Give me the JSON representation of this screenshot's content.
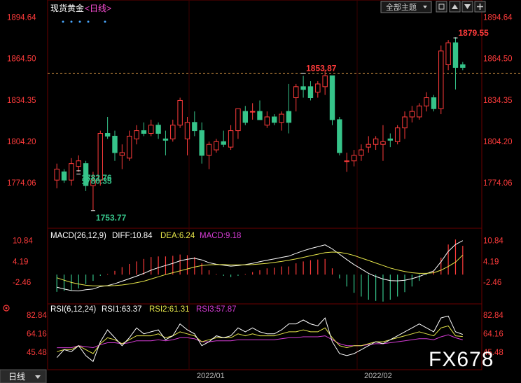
{
  "header": {
    "symbol": "现货黄金",
    "period_link": "<日线>",
    "theme_button": "全部主题",
    "window_controls": [
      "restore-icon",
      "up-icon",
      "down-icon",
      "plus-icon"
    ]
  },
  "price_axis": {
    "ticks": [
      "1894.64",
      "1864.50",
      "1834.35",
      "1804.20",
      "1774.06"
    ]
  },
  "macd_axis": {
    "ticks": [
      "10.84",
      "4.19",
      "-2.46"
    ]
  },
  "rsi_axis": {
    "ticks": [
      "82.84",
      "64.16",
      "45.48"
    ]
  },
  "time_axis": {
    "labels": [
      "2022/01",
      "2022/02"
    ]
  },
  "footer": {
    "period_tab": "日线",
    "watermark": "FX678"
  },
  "colors": {
    "up": "#ff3b3b",
    "down": "#36c48a",
    "dashed_level": "#e8a24a",
    "macd_diff": "#ffffff",
    "macd_dea": "#e6e64a",
    "rsi1": "#ffffff",
    "rsi2": "#e6e64a",
    "rsi3": "#d63cd6",
    "label_high": "#ff3b3b",
    "label_low": "#36c48a",
    "grid": "#6b0000"
  },
  "chart_data": [
    {
      "type": "candlestick",
      "title": "现货黄金",
      "ylim": [
        1745,
        1900
      ],
      "x_labels": [
        "2022/01",
        "2022/02"
      ],
      "reference_level": 1853.87,
      "annotations": [
        {
          "text": "1879.55",
          "value": 1879.55,
          "kind": "high"
        },
        {
          "text": "1853.87",
          "value": 1853.87,
          "kind": "high"
        },
        {
          "text": "1753.77",
          "value": 1753.77,
          "kind": "low"
        },
        {
          "text": "1782.76",
          "value": 1782.76,
          "kind": "low"
        },
        {
          "text": "1780.35",
          "value": 1780.35,
          "kind": "low"
        }
      ],
      "ohlc": [
        [
          1776,
          1788,
          1770,
          1784
        ],
        [
          1782,
          1784,
          1774,
          1776
        ],
        [
          1776,
          1792,
          1772,
          1788
        ],
        [
          1786,
          1794,
          1782,
          1790
        ],
        [
          1788,
          1790,
          1768,
          1772
        ],
        [
          1772,
          1782,
          1754,
          1776
        ],
        [
          1776,
          1812,
          1772,
          1810
        ],
        [
          1810,
          1822,
          1806,
          1808
        ],
        [
          1808,
          1812,
          1790,
          1796
        ],
        [
          1794,
          1802,
          1784,
          1796
        ],
        [
          1792,
          1812,
          1790,
          1808
        ],
        [
          1806,
          1816,
          1802,
          1812
        ],
        [
          1812,
          1818,
          1808,
          1810
        ],
        [
          1810,
          1820,
          1808,
          1816
        ],
        [
          1816,
          1818,
          1806,
          1810
        ],
        [
          1806,
          1812,
          1794,
          1805
        ],
        [
          1806,
          1820,
          1804,
          1816
        ],
        [
          1816,
          1836,
          1814,
          1834
        ],
        [
          1806,
          1822,
          1794,
          1818
        ],
        [
          1818,
          1826,
          1808,
          1812
        ],
        [
          1812,
          1818,
          1788,
          1794
        ],
        [
          1794,
          1804,
          1784,
          1802
        ],
        [
          1798,
          1806,
          1796,
          1804
        ],
        [
          1804,
          1812,
          1800,
          1802
        ],
        [
          1800,
          1816,
          1798,
          1812
        ],
        [
          1812,
          1826,
          1806,
          1828
        ],
        [
          1826,
          1830,
          1816,
          1818
        ],
        [
          1826,
          1832,
          1820,
          1826
        ],
        [
          1826,
          1834,
          1822,
          1820
        ],
        [
          1816,
          1826,
          1814,
          1822
        ],
        [
          1822,
          1824,
          1816,
          1818
        ],
        [
          1818,
          1826,
          1812,
          1824
        ],
        [
          1826,
          1846,
          1810,
          1818
        ],
        [
          1836,
          1846,
          1826,
          1844
        ],
        [
          1844,
          1852,
          1836,
          1842
        ],
        [
          1844,
          1848,
          1834,
          1836
        ],
        [
          1840,
          1848,
          1836,
          1846
        ],
        [
          1844,
          1856,
          1838,
          1852
        ],
        [
          1852,
          1852,
          1816,
          1820
        ],
        [
          1820,
          1822,
          1794,
          1796
        ],
        [
          1790,
          1796,
          1782,
          1790
        ],
        [
          1790,
          1798,
          1786,
          1794
        ],
        [
          1794,
          1802,
          1790,
          1798
        ],
        [
          1800,
          1808,
          1796,
          1802
        ],
        [
          1802,
          1808,
          1798,
          1806
        ],
        [
          1802,
          1816,
          1790,
          1804
        ],
        [
          1806,
          1810,
          1800,
          1805
        ],
        [
          1804,
          1816,
          1802,
          1814
        ],
        [
          1814,
          1826,
          1806,
          1822
        ],
        [
          1822,
          1830,
          1818,
          1826
        ],
        [
          1822,
          1832,
          1820,
          1830
        ],
        [
          1830,
          1840,
          1826,
          1836
        ],
        [
          1836,
          1838,
          1826,
          1828
        ],
        [
          1828,
          1874,
          1824,
          1870
        ],
        [
          1860,
          1878,
          1856,
          1876
        ],
        [
          1876,
          1880,
          1842,
          1858
        ],
        [
          1860,
          1862,
          1856,
          1858
        ]
      ]
    },
    {
      "type": "bar",
      "title": "MACD(26,12,9)",
      "legend": [
        {
          "text": "DIFF:10.84",
          "color_key": "macd_diff"
        },
        {
          "text": "DEA:6.24",
          "color_key": "macd_dea"
        },
        {
          "text": "MACD:9.18",
          "color_key": "rsi3"
        }
      ],
      "ylim": [
        -8,
        13
      ],
      "series": [
        {
          "name": "DIFF",
          "values": [
            -4,
            -4.6,
            -5.1,
            -5.2,
            -4.8,
            -4.6,
            -3.8,
            -3.5,
            -2.9,
            -2.1,
            -1.3,
            -0.5,
            0.4,
            1.4,
            2.2,
            2.9,
            3.6,
            4.4,
            4.9,
            5.2,
            4.7,
            3.8,
            3.3,
            3.0,
            2.7,
            2.9,
            3.2,
            3.6,
            4.1,
            4.6,
            5.0,
            5.5,
            5.9,
            6.8,
            7.6,
            8.3,
            8.9,
            9.5,
            8.2,
            6.5,
            4.8,
            3.2,
            1.8,
            0.4,
            -0.6,
            -1.4,
            -1.9,
            -2.0,
            -1.8,
            -1.3,
            -0.6,
            0.3,
            1.2,
            4.1,
            7.4,
            9.6,
            10.84
          ]
        },
        {
          "name": "DEA",
          "values": [
            -1.0,
            -1.8,
            -2.5,
            -3.0,
            -3.4,
            -3.6,
            -3.6,
            -3.6,
            -3.5,
            -3.3,
            -3.0,
            -2.6,
            -2.1,
            -1.4,
            -0.7,
            0.0,
            0.6,
            1.2,
            1.8,
            2.4,
            2.9,
            3.1,
            3.2,
            3.2,
            3.1,
            3.1,
            3.1,
            3.2,
            3.4,
            3.6,
            3.9,
            4.2,
            4.6,
            5.0,
            5.5,
            6.0,
            6.5,
            7.0,
            7.2,
            7.1,
            6.7,
            6.1,
            5.3,
            4.5,
            3.7,
            2.9,
            2.1,
            1.5,
            1.0,
            0.6,
            0.4,
            0.4,
            0.6,
            1.4,
            2.6,
            4.0,
            6.24
          ]
        },
        {
          "name": "MACD",
          "values": [
            -5.5,
            -5.2,
            -5.0,
            -4.4,
            -3.0,
            -2.0,
            -0.4,
            0.2,
            1.2,
            2.4,
            3.4,
            4.2,
            5.0,
            5.6,
            5.8,
            5.8,
            6.0,
            6.4,
            6.2,
            5.6,
            3.6,
            1.4,
            0.2,
            -0.4,
            -0.8,
            -0.4,
            0.2,
            0.8,
            1.4,
            2.0,
            2.2,
            2.6,
            2.6,
            3.6,
            4.2,
            4.6,
            4.8,
            5.0,
            2.0,
            -1.2,
            -3.8,
            -5.8,
            -7.0,
            -8.0,
            -8.4,
            -8.6,
            -8.0,
            -7.0,
            -5.6,
            -3.8,
            -2.0,
            -0.2,
            1.2,
            5.4,
            9.6,
            11.2,
            9.18
          ]
        }
      ]
    },
    {
      "type": "line",
      "title": "RSI(6,12,24)",
      "legend": [
        {
          "text": "RSI1:63.37",
          "color_key": "rsi1"
        },
        {
          "text": "RSI2:61.31",
          "color_key": "rsi2"
        },
        {
          "text": "RSI3:57.87",
          "color_key": "rsi3"
        }
      ],
      "ylim": [
        32,
        90
      ],
      "series": [
        {
          "name": "RSI1",
          "values": [
            40,
            48,
            46,
            52,
            42,
            36,
            56,
            68,
            60,
            52,
            60,
            70,
            64,
            66,
            68,
            58,
            62,
            74,
            68,
            64,
            52,
            56,
            62,
            60,
            62,
            70,
            66,
            70,
            66,
            64,
            64,
            68,
            74,
            74,
            78,
            74,
            72,
            80,
            56,
            44,
            42,
            44,
            48,
            52,
            56,
            54,
            58,
            62,
            66,
            70,
            74,
            70,
            66,
            80,
            82,
            66,
            63.37
          ]
        },
        {
          "name": "RSI2",
          "values": [
            46,
            48,
            48,
            52,
            48,
            44,
            54,
            60,
            58,
            54,
            58,
            62,
            62,
            62,
            64,
            60,
            62,
            66,
            64,
            62,
            56,
            58,
            60,
            60,
            60,
            64,
            62,
            64,
            62,
            62,
            62,
            64,
            66,
            66,
            68,
            66,
            66,
            70,
            60,
            52,
            50,
            52,
            52,
            54,
            56,
            56,
            58,
            60,
            62,
            64,
            66,
            64,
            62,
            70,
            72,
            62,
            61.31
          ]
        },
        {
          "name": "RSI3",
          "values": [
            50,
            50,
            50,
            52,
            51,
            50,
            53,
            55,
            55,
            54,
            55,
            57,
            57,
            57,
            58,
            57,
            58,
            60,
            60,
            59,
            56,
            56,
            57,
            57,
            57,
            58,
            58,
            58,
            58,
            58,
            58,
            59,
            60,
            60,
            61,
            61,
            61,
            62,
            58,
            54,
            52,
            52,
            52,
            53,
            54,
            54,
            55,
            56,
            57,
            58,
            59,
            59,
            58,
            61,
            63,
            60,
            57.87
          ]
        }
      ]
    }
  ]
}
